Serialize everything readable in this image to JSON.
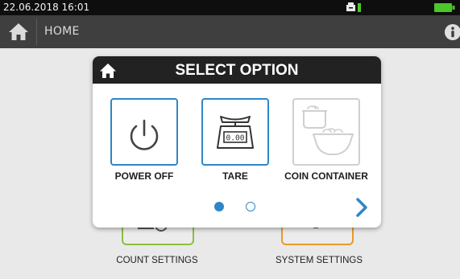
{
  "status_bar": {
    "datetime": "22.06.2018  16:01"
  },
  "header": {
    "title": "HOME"
  },
  "background_menu": {
    "items": [
      {
        "label": "COUNT SETTINGS",
        "accent": "#8cbf3f"
      },
      {
        "label": "SYSTEM SETTINGS",
        "accent": "#e89a2c"
      }
    ]
  },
  "dialog": {
    "title": "SELECT OPTION",
    "options": [
      {
        "label": "POWER OFF",
        "icon": "power-icon",
        "state": "active"
      },
      {
        "label": "TARE",
        "icon": "scale-icon",
        "scale_display": "0.00",
        "state": "active"
      },
      {
        "label": "COIN CONTAINER",
        "icon": "coin-container-icon",
        "state": "disabled"
      }
    ],
    "pagination": {
      "current_page": 1,
      "total_pages": 2
    },
    "next_icon": "chevron-right-icon"
  },
  "colors": {
    "accent_blue": "#2f86c6",
    "header_bg": "#3f3f3f",
    "dialog_header_bg": "#222222",
    "battery_green": "#4cc62a"
  }
}
